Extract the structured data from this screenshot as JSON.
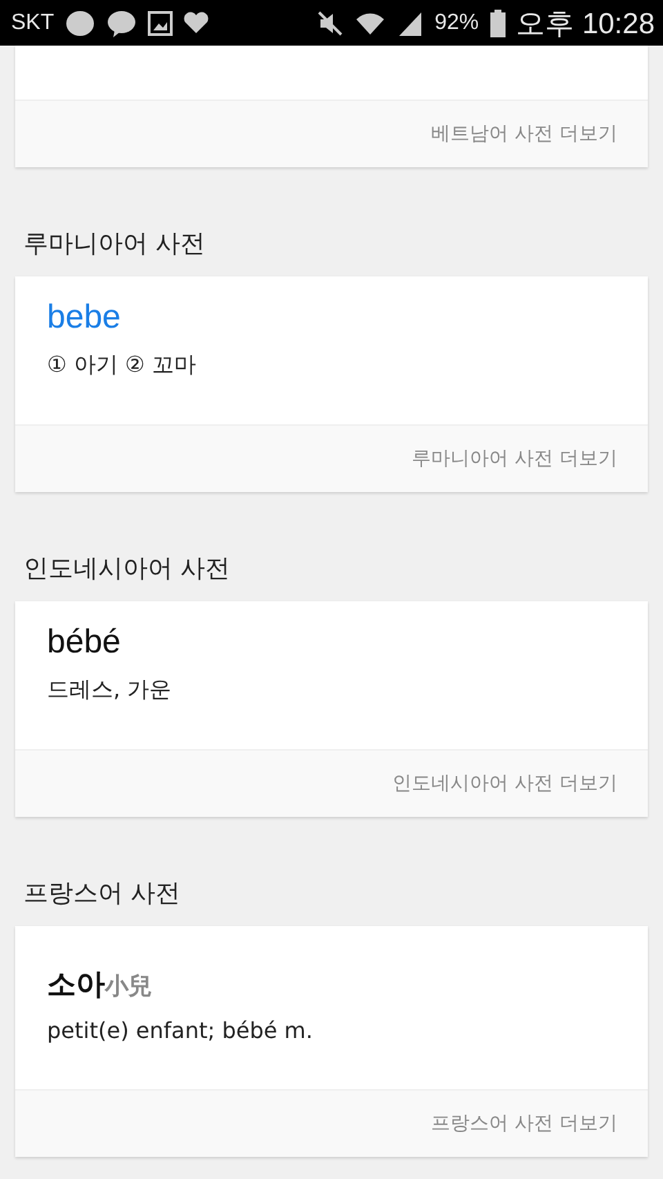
{
  "status_bar": {
    "carrier": "SKT",
    "battery": "92%",
    "time": "오후 10:28"
  },
  "top_card": {
    "more": "베트남어 사전 더보기"
  },
  "sections": [
    {
      "title": "루마니아어 사전",
      "word": "bebe",
      "kind": "link",
      "meaning": "① 아기 ② 꼬마",
      "more": "루마니아어 사전 더보기"
    },
    {
      "title": "인도네시아어 사전",
      "word": "bébé",
      "kind": "plain",
      "meaning": "드레스, 가운",
      "more": "인도네시아어 사전 더보기"
    },
    {
      "title": "프랑스어 사전",
      "word": "소아",
      "hanja": "小兒",
      "kind": "hanja",
      "meaning": "petit(e) enfant; bébé m.",
      "more": "프랑스어 사전 더보기"
    }
  ]
}
